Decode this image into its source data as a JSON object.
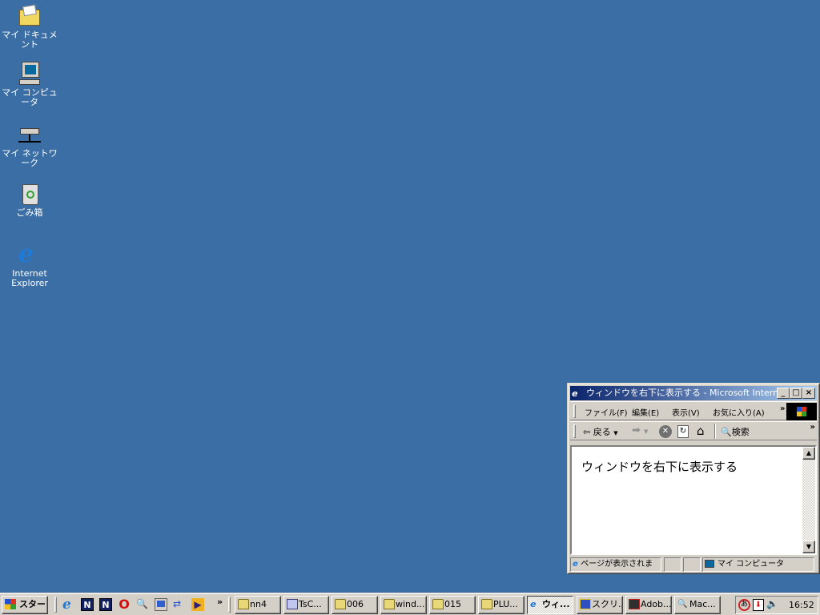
{
  "desktop": {
    "icons": [
      {
        "label": "マイ ドキュメント",
        "icon": "my-documents-icon"
      },
      {
        "label": "マイ コンピュータ",
        "icon": "my-computer-icon"
      },
      {
        "label": "マイ ネットワーク",
        "icon": "my-network-icon"
      },
      {
        "label": "ごみ箱",
        "icon": "recycle-bin-icon"
      },
      {
        "label": "Internet Explorer",
        "icon": "internet-explorer-icon"
      }
    ]
  },
  "window": {
    "title": "ウィンドウを右下に表示する - Microsoft Interne...",
    "menu": [
      "ファイル(F)",
      "編集(E)",
      "表示(V)",
      "お気に入り(A)"
    ],
    "chevron": "»",
    "toolbar": {
      "back": "戻る",
      "search": "検索"
    },
    "content_text": "ウィンドウを右下に表示する",
    "status": {
      "text": "ページが表示されま",
      "zone": "マイ コンピュータ"
    }
  },
  "taskbar": {
    "start": "スタート",
    "chevron": "»",
    "buttons": [
      {
        "label": "nn4",
        "icon": "folder-icon"
      },
      {
        "label": "TsC...",
        "icon": "app-icon"
      },
      {
        "label": "006",
        "icon": "folder-icon"
      },
      {
        "label": "wind...",
        "icon": "folder-icon"
      },
      {
        "label": "015",
        "icon": "folder-icon"
      },
      {
        "label": "PLU...",
        "icon": "folder-icon"
      },
      {
        "label": "ウィ...",
        "icon": "internet-explorer-icon",
        "active": true
      },
      {
        "label": "スクリ...",
        "icon": "screensaver-icon"
      },
      {
        "label": "Adob...",
        "icon": "adobe-icon"
      },
      {
        "label": "Mac...",
        "icon": "computer-search-icon"
      }
    ],
    "clock": "16:52"
  }
}
